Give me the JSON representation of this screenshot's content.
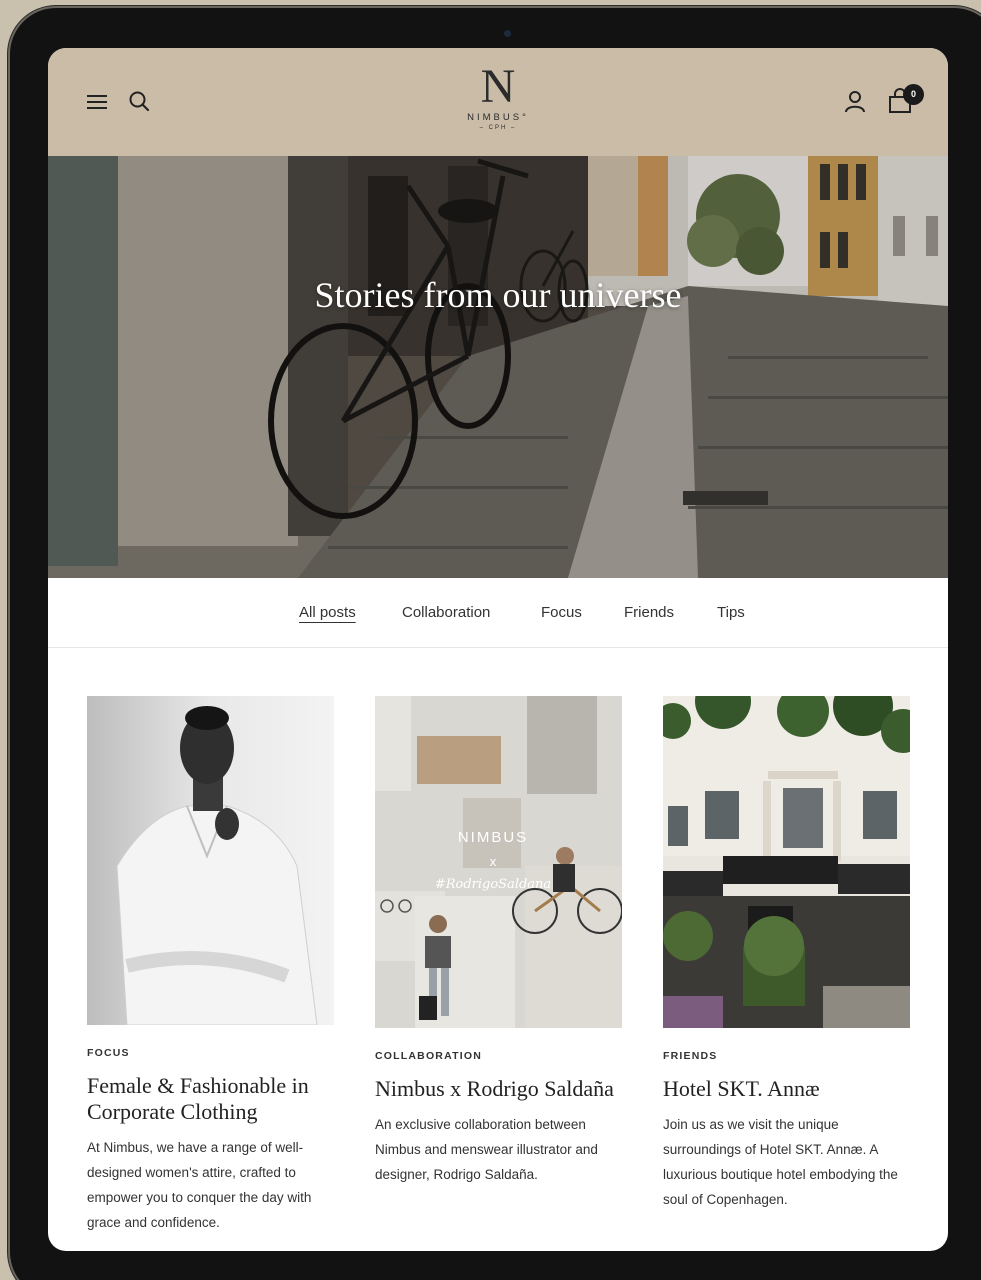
{
  "header": {
    "logo_mark": "N",
    "logo_word": "NIMBUS°",
    "logo_sub": "– CPH –",
    "cart_count": "0",
    "icons": [
      "menu-icon",
      "search-icon",
      "user-icon",
      "bag-icon"
    ]
  },
  "hero": {
    "title": "Stories from our universe"
  },
  "tabs": [
    {
      "label": "All posts",
      "active": true
    },
    {
      "label": "Collaboration",
      "active": false
    },
    {
      "label": "Focus",
      "active": false
    },
    {
      "label": "Friends",
      "active": false
    },
    {
      "label": "Tips",
      "active": false
    }
  ],
  "posts": [
    {
      "category": "FOCUS",
      "title": "Female & Fashionable in Corporate Clothing",
      "excerpt": "At Nimbus, we have a range of well-designed women's attire, crafted to empower you to conquer the day with grace and confidence."
    },
    {
      "category": "COLLABORATION",
      "title": "Nimbus x Rodrigo Saldaña",
      "excerpt": "An exclusive collaboration between Nimbus and menswear illustrator and designer, Rodrigo Saldaña.",
      "image_text": [
        "NIMBUS",
        "x",
        "#RodrigoSaldana"
      ]
    },
    {
      "category": "FRIENDS",
      "title": "Hotel SKT. Annæ",
      "excerpt": "Join us as we visit the unique surroundings of Hotel SKT. Annæ.  A luxurious boutique hotel embodying the soul of Copenhagen."
    }
  ],
  "colors": {
    "header_bg": "#cbbca7",
    "text": "#222222",
    "badge": "#1a1a1a"
  }
}
